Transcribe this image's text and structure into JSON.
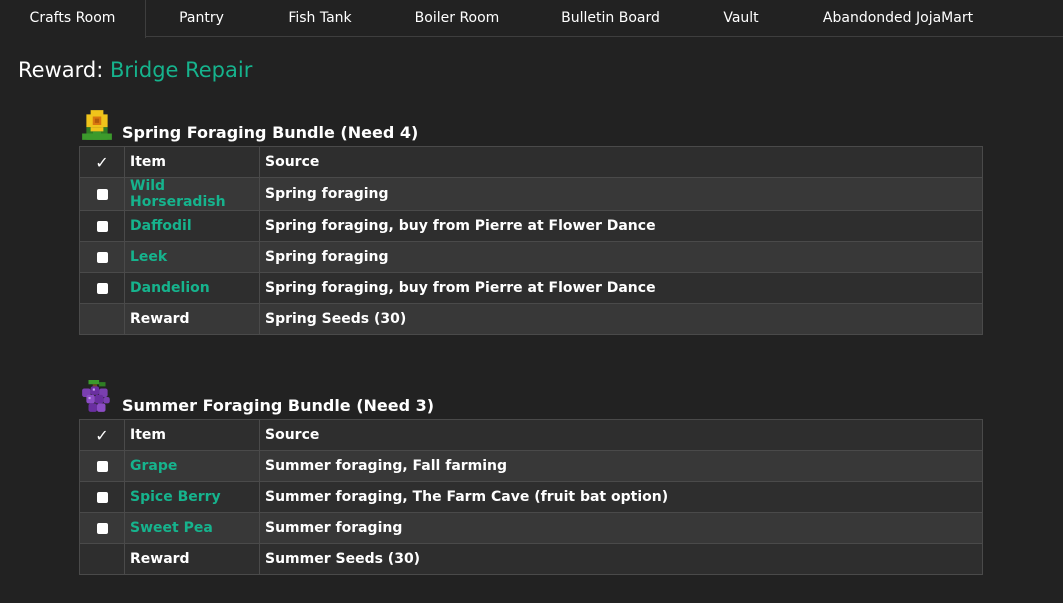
{
  "tabs": [
    "Crafts Room",
    "Pantry",
    "Fish Tank",
    "Boiler Room",
    "Bulletin Board",
    "Vault",
    "Abandonded JojaMart"
  ],
  "reward": {
    "label": "Reward:",
    "value": "Bridge Repair"
  },
  "headers": {
    "check": "✓",
    "item": "Item",
    "source": "Source"
  },
  "spring": {
    "title": "Spring Foraging Bundle (Need 4)",
    "icon": "spring-flower-icon",
    "items": [
      {
        "name": "Wild Horseradish",
        "source": "Spring foraging"
      },
      {
        "name": "Daffodil",
        "source": "Spring foraging, buy from Pierre at Flower Dance"
      },
      {
        "name": "Leek",
        "source": "Spring foraging"
      },
      {
        "name": "Dandelion",
        "source": "Spring foraging, buy from Pierre at Flower Dance"
      }
    ],
    "reward_label": "Reward",
    "reward_value": "Spring Seeds (30)"
  },
  "summer": {
    "title": "Summer Foraging Bundle (Need 3)",
    "icon": "grape-icon",
    "items": [
      {
        "name": "Grape",
        "source": "Summer foraging, Fall farming"
      },
      {
        "name": "Spice Berry",
        "source": "Summer foraging, The Farm Cave (fruit bat option)"
      },
      {
        "name": "Sweet Pea",
        "source": "Summer foraging"
      }
    ],
    "reward_label": "Reward",
    "reward_value": "Summer Seeds (30)"
  },
  "colors": {
    "background": "#222222",
    "accent": "#16b38d",
    "row_odd": "#2e2e2e",
    "row_even": "#383838"
  }
}
